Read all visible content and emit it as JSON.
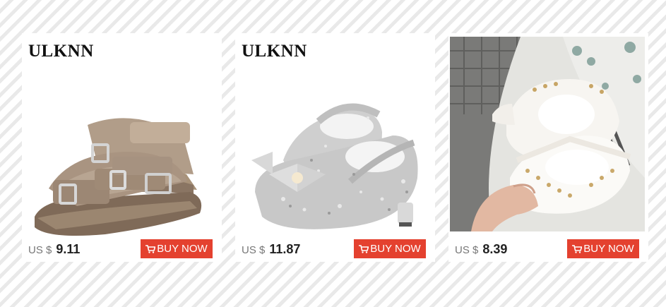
{
  "products": [
    {
      "brand": "ULKNN",
      "currency": "US $",
      "price": "9.11",
      "buy_label": "BUY NOW",
      "image": "tan-suede-buckle-sandals"
    },
    {
      "brand": "ULKNN",
      "currency": "US $",
      "price": "11.87",
      "buy_label": "BUY NOW",
      "image": "silver-glitter-bow-shoes"
    },
    {
      "currency": "US $",
      "price": "8.39",
      "buy_label": "BUY NOW",
      "image": "white-studded-pointed-sandals"
    }
  ],
  "colors": {
    "button": "#e4412f",
    "brand_text": "#111111",
    "price_text": "#222222",
    "currency_text": "#777777"
  },
  "icons": {
    "cart": "shopping-cart-icon"
  }
}
